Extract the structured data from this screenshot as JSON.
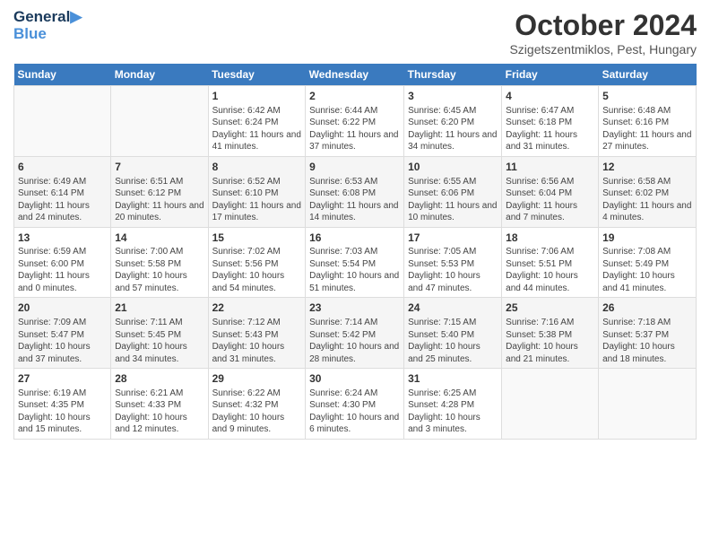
{
  "header": {
    "logo_line1": "General",
    "logo_line2": "Blue",
    "month": "October 2024",
    "location": "Szigetszentmiklos, Pest, Hungary"
  },
  "days_of_week": [
    "Sunday",
    "Monday",
    "Tuesday",
    "Wednesday",
    "Thursday",
    "Friday",
    "Saturday"
  ],
  "weeks": [
    [
      {
        "day": "",
        "content": ""
      },
      {
        "day": "",
        "content": ""
      },
      {
        "day": "1",
        "content": "Sunrise: 6:42 AM\nSunset: 6:24 PM\nDaylight: 11 hours and 41 minutes."
      },
      {
        "day": "2",
        "content": "Sunrise: 6:44 AM\nSunset: 6:22 PM\nDaylight: 11 hours and 37 minutes."
      },
      {
        "day": "3",
        "content": "Sunrise: 6:45 AM\nSunset: 6:20 PM\nDaylight: 11 hours and 34 minutes."
      },
      {
        "day": "4",
        "content": "Sunrise: 6:47 AM\nSunset: 6:18 PM\nDaylight: 11 hours and 31 minutes."
      },
      {
        "day": "5",
        "content": "Sunrise: 6:48 AM\nSunset: 6:16 PM\nDaylight: 11 hours and 27 minutes."
      }
    ],
    [
      {
        "day": "6",
        "content": "Sunrise: 6:49 AM\nSunset: 6:14 PM\nDaylight: 11 hours and 24 minutes."
      },
      {
        "day": "7",
        "content": "Sunrise: 6:51 AM\nSunset: 6:12 PM\nDaylight: 11 hours and 20 minutes."
      },
      {
        "day": "8",
        "content": "Sunrise: 6:52 AM\nSunset: 6:10 PM\nDaylight: 11 hours and 17 minutes."
      },
      {
        "day": "9",
        "content": "Sunrise: 6:53 AM\nSunset: 6:08 PM\nDaylight: 11 hours and 14 minutes."
      },
      {
        "day": "10",
        "content": "Sunrise: 6:55 AM\nSunset: 6:06 PM\nDaylight: 11 hours and 10 minutes."
      },
      {
        "day": "11",
        "content": "Sunrise: 6:56 AM\nSunset: 6:04 PM\nDaylight: 11 hours and 7 minutes."
      },
      {
        "day": "12",
        "content": "Sunrise: 6:58 AM\nSunset: 6:02 PM\nDaylight: 11 hours and 4 minutes."
      }
    ],
    [
      {
        "day": "13",
        "content": "Sunrise: 6:59 AM\nSunset: 6:00 PM\nDaylight: 11 hours and 0 minutes."
      },
      {
        "day": "14",
        "content": "Sunrise: 7:00 AM\nSunset: 5:58 PM\nDaylight: 10 hours and 57 minutes."
      },
      {
        "day": "15",
        "content": "Sunrise: 7:02 AM\nSunset: 5:56 PM\nDaylight: 10 hours and 54 minutes."
      },
      {
        "day": "16",
        "content": "Sunrise: 7:03 AM\nSunset: 5:54 PM\nDaylight: 10 hours and 51 minutes."
      },
      {
        "day": "17",
        "content": "Sunrise: 7:05 AM\nSunset: 5:53 PM\nDaylight: 10 hours and 47 minutes."
      },
      {
        "day": "18",
        "content": "Sunrise: 7:06 AM\nSunset: 5:51 PM\nDaylight: 10 hours and 44 minutes."
      },
      {
        "day": "19",
        "content": "Sunrise: 7:08 AM\nSunset: 5:49 PM\nDaylight: 10 hours and 41 minutes."
      }
    ],
    [
      {
        "day": "20",
        "content": "Sunrise: 7:09 AM\nSunset: 5:47 PM\nDaylight: 10 hours and 37 minutes."
      },
      {
        "day": "21",
        "content": "Sunrise: 7:11 AM\nSunset: 5:45 PM\nDaylight: 10 hours and 34 minutes."
      },
      {
        "day": "22",
        "content": "Sunrise: 7:12 AM\nSunset: 5:43 PM\nDaylight: 10 hours and 31 minutes."
      },
      {
        "day": "23",
        "content": "Sunrise: 7:14 AM\nSunset: 5:42 PM\nDaylight: 10 hours and 28 minutes."
      },
      {
        "day": "24",
        "content": "Sunrise: 7:15 AM\nSunset: 5:40 PM\nDaylight: 10 hours and 25 minutes."
      },
      {
        "day": "25",
        "content": "Sunrise: 7:16 AM\nSunset: 5:38 PM\nDaylight: 10 hours and 21 minutes."
      },
      {
        "day": "26",
        "content": "Sunrise: 7:18 AM\nSunset: 5:37 PM\nDaylight: 10 hours and 18 minutes."
      }
    ],
    [
      {
        "day": "27",
        "content": "Sunrise: 6:19 AM\nSunset: 4:35 PM\nDaylight: 10 hours and 15 minutes."
      },
      {
        "day": "28",
        "content": "Sunrise: 6:21 AM\nSunset: 4:33 PM\nDaylight: 10 hours and 12 minutes."
      },
      {
        "day": "29",
        "content": "Sunrise: 6:22 AM\nSunset: 4:32 PM\nDaylight: 10 hours and 9 minutes."
      },
      {
        "day": "30",
        "content": "Sunrise: 6:24 AM\nSunset: 4:30 PM\nDaylight: 10 hours and 6 minutes."
      },
      {
        "day": "31",
        "content": "Sunrise: 6:25 AM\nSunset: 4:28 PM\nDaylight: 10 hours and 3 minutes."
      },
      {
        "day": "",
        "content": ""
      },
      {
        "day": "",
        "content": ""
      }
    ]
  ]
}
